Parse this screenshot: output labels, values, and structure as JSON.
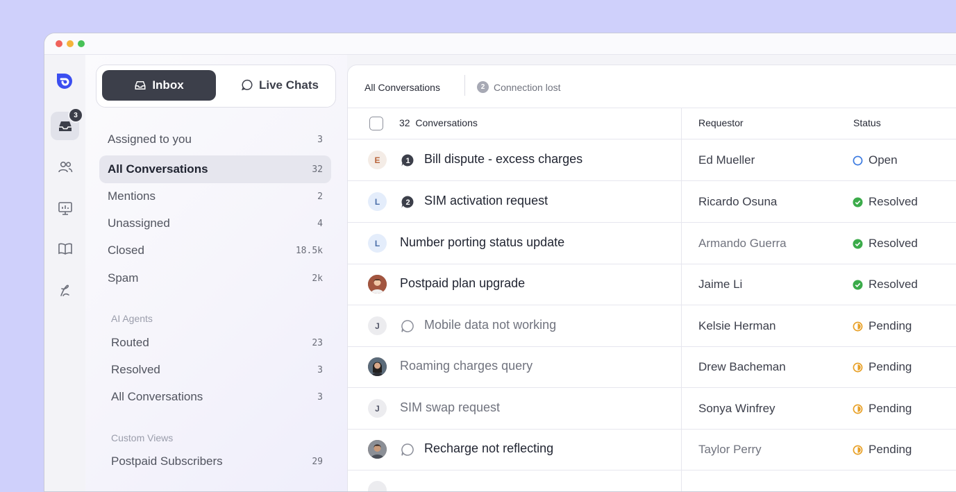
{
  "rail": {
    "inbox_badge": "3",
    "icons": [
      "logo-icon",
      "inbox-icon",
      "contacts-icon",
      "reports-icon",
      "knowledge-base-icon",
      "integrations-icon"
    ]
  },
  "sidebar": {
    "segment": {
      "inbox_label": "Inbox",
      "live_chats_label": "Live Chats"
    },
    "items": [
      {
        "label": "Assigned to you",
        "count": "3"
      },
      {
        "label": "All Conversations",
        "count": "32"
      },
      {
        "label": "Mentions",
        "count": "2"
      },
      {
        "label": "Unassigned",
        "count": "4"
      },
      {
        "label": "Closed",
        "count": "18.5k"
      },
      {
        "label": "Spam",
        "count": "2k"
      }
    ],
    "ai_agents": {
      "label": "AI Agents",
      "items": [
        {
          "label": "Routed",
          "count": "23"
        },
        {
          "label": "Resolved",
          "count": "3"
        },
        {
          "label": "All Conversations",
          "count": "3"
        }
      ]
    },
    "custom_views": {
      "label": "Custom Views",
      "items": [
        {
          "label": "Postpaid Subscribers",
          "count": "29"
        }
      ]
    }
  },
  "main": {
    "tab_active": "All Conversations",
    "warning": {
      "badge": "2",
      "text": "Connection lost"
    },
    "header": {
      "count": "32",
      "conversations_label": "Conversations",
      "requestor_label": "Requestor",
      "status_label": "Status"
    },
    "rows": [
      {
        "avatar": "E",
        "unread_badge": "1",
        "subject": "Bill dispute - excess charges",
        "requestor": "Ed Mueller",
        "status": "Open"
      },
      {
        "avatar": "L",
        "unread_badge": "2",
        "subject": "SIM activation request",
        "requestor": "Ricardo Osuna",
        "status": "Resolved"
      },
      {
        "avatar": "L",
        "subject": "Number porting status update",
        "requestor": "Armando Guerra",
        "status": "Resolved"
      },
      {
        "avatar": "photo",
        "subject": "Postpaid plan upgrade",
        "requestor": "Jaime Li",
        "status": "Resolved"
      },
      {
        "avatar": "J",
        "subject": "Mobile data not working",
        "requestor": "Kelsie Herman",
        "status": "Pending"
      },
      {
        "avatar": "photo",
        "subject": "Roaming charges query",
        "requestor": "Drew Bacheman",
        "status": "Pending"
      },
      {
        "avatar": "J",
        "subject": "SIM swap request",
        "requestor": "Sonya Winfrey",
        "status": "Pending"
      },
      {
        "avatar": "photo",
        "subject": "Recharge not reflecting",
        "requestor": "Taylor Perry",
        "status": "Pending"
      }
    ]
  },
  "colors": {
    "accent": "#3b4ef0",
    "open": "#3b7ae0",
    "resolved": "#3bab4a",
    "pending": "#e8a026",
    "dark_button": "#3c3f4a"
  }
}
